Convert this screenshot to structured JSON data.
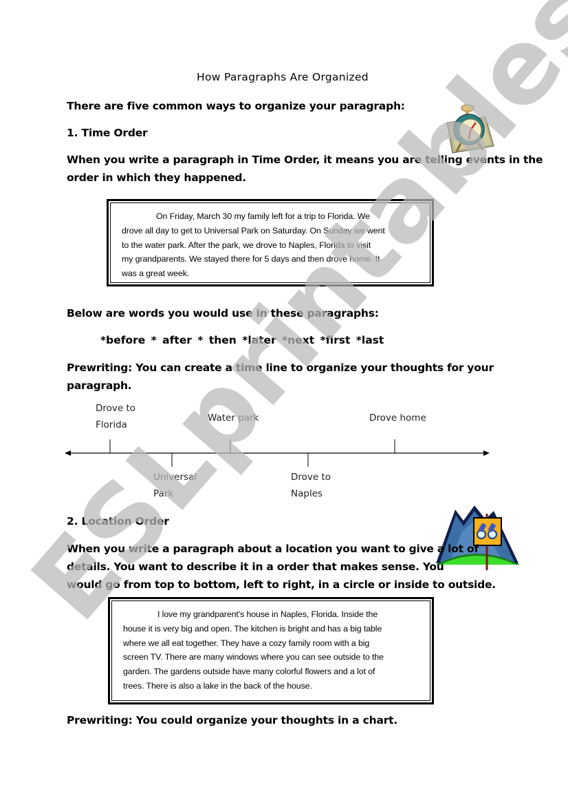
{
  "title": "How Paragraphs Are Organized",
  "intro": "There are five common ways to organize your paragraph:",
  "section1": {
    "heading": "1.  Time Order",
    "icon": "alarm-clock-icon",
    "description_lines": [
      "When you write a paragraph in Time Order, it means you are telling events in the",
      "order in which they happened."
    ],
    "example_lines": [
      "On Friday, March 30 my family left for a trip to Florida.  We",
      "drove all day to get to Universal Park on Saturday.  On Sunday we went",
      "to the water park.  After the park, we drove to Naples, Florida to visit",
      "my grandparents.  We stayed there for 5 days and then drove home.  It",
      "was a great week."
    ],
    "words_intro": "Below are words you would use in these paragraphs:",
    "words": "*before  * after  * then   *later   *next   *first   *last",
    "prewriting_lines": [
      "Prewriting:  You can create a time line to organize your thoughts for your",
      "paragraph."
    ],
    "timeline": {
      "events": [
        {
          "lines": [
            "Drove to",
            "Florida"
          ],
          "side": "above"
        },
        {
          "lines": [
            "Universal",
            "Park"
          ],
          "side": "below"
        },
        {
          "lines": [
            "Water park"
          ],
          "side": "above"
        },
        {
          "lines": [
            "Drove to",
            "Naples"
          ],
          "side": "below"
        },
        {
          "lines": [
            "Drove home"
          ],
          "side": "above"
        }
      ]
    }
  },
  "section2": {
    "heading": "2.  Location Order",
    "icon": "mountain-binoculars-sign-icon",
    "description_lines": [
      "When you write a paragraph about a location you want to give a lot of",
      "details.  You want to describe it in a order that makes sense.   You",
      "would go from top to bottom, left to right, in a circle or inside to outside."
    ],
    "example_lines": [
      "I love my grandparent's house in Naples, Florida.  Inside the",
      "house it is very big and open.  The kitchen is bright and has a big table",
      "where we all eat together.  They have a cozy family room with a big",
      "screen TV.   There are many windows where you can see outside to the",
      "garden.  The gardens outside have many colorful flowers and a lot of",
      "trees.  There is also a lake in the back of the house."
    ],
    "prewriting": "Prewriting:  You could organize your thoughts in a chart."
  },
  "watermark": "ESLprintables.com"
}
